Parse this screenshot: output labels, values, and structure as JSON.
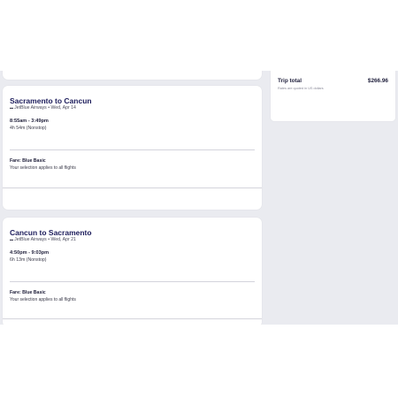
{
  "flights": [
    {
      "route": "Sacramento to Cancun",
      "airline_date": "JetBlue Airways • Wed, Apr 14",
      "times": "8:55am - 3:49pm",
      "duration": "4h 54m (Nonstop)",
      "fare": "Fare: Blue Basic",
      "note": "Your selection applies to all flights"
    },
    {
      "route": "Cancun to Sacramento",
      "airline_date": "JetBlue Airways • Wed, Apr 21",
      "times": "4:50pm - 9:03pm",
      "duration": "6h 13m (Nonstop)",
      "fare": "Fare: Blue Basic",
      "note": "Your selection applies to all flights"
    }
  ],
  "summary": {
    "label": "Trip total",
    "price": "$266.96",
    "note": "Rates are quoted in US dollars"
  }
}
